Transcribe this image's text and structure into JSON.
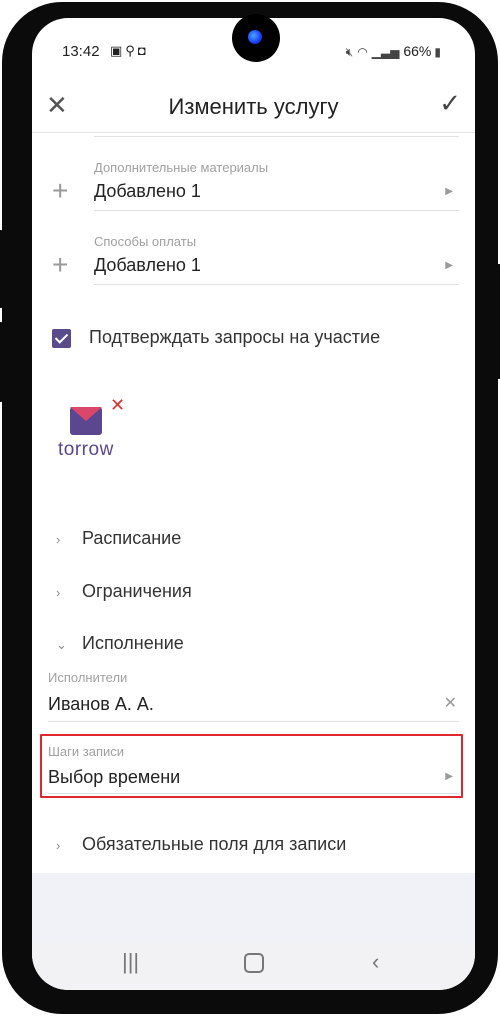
{
  "status_bar": {
    "time": "13:42",
    "left_icons": [
      "image-icon",
      "search-icon",
      "camera-icon"
    ],
    "battery": "66%"
  },
  "header": {
    "title": "Изменить услугу"
  },
  "fields": [
    {
      "label": "Дополнительные материалы",
      "value": "Добавлено 1"
    },
    {
      "label": "Способы оплаты",
      "value": "Добавлено 1"
    }
  ],
  "confirm_checkbox": {
    "label": "Подтверждать запросы на участие",
    "checked": true
  },
  "logo": {
    "text": "torrow"
  },
  "sections": {
    "schedule": "Расписание",
    "restrictions": "Ограничения",
    "execution": "Исполнение",
    "required_fields": "Обязательные поля для записи"
  },
  "executors": {
    "label": "Исполнители",
    "value": "Иванов А. А."
  },
  "booking_steps": {
    "label": "Шаги записи",
    "value": "Выбор времени"
  },
  "colors": {
    "accent": "#5a4b8c",
    "highlight": "#e0262e"
  }
}
